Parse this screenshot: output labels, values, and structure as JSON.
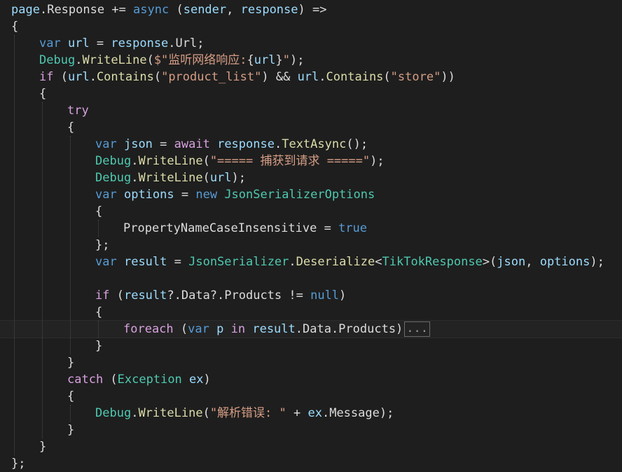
{
  "editor": {
    "lines": [
      {
        "indent": 0,
        "tokens": [
          {
            "t": "page",
            "c": "var"
          },
          {
            "t": ".",
            "c": "plain"
          },
          {
            "t": "Response",
            "c": "plain"
          },
          {
            "t": " += ",
            "c": "plain"
          },
          {
            "t": "async",
            "c": "kw"
          },
          {
            "t": " (",
            "c": "plain"
          },
          {
            "t": "sender",
            "c": "var"
          },
          {
            "t": ", ",
            "c": "plain"
          },
          {
            "t": "response",
            "c": "var"
          },
          {
            "t": ") =>",
            "c": "plain"
          }
        ]
      },
      {
        "indent": 0,
        "tokens": [
          {
            "t": "{",
            "c": "plain"
          }
        ]
      },
      {
        "indent": 1,
        "tokens": [
          {
            "t": "var",
            "c": "kw"
          },
          {
            "t": " ",
            "c": "plain"
          },
          {
            "t": "url",
            "c": "var"
          },
          {
            "t": " = ",
            "c": "plain"
          },
          {
            "t": "response",
            "c": "var"
          },
          {
            "t": ".",
            "c": "plain"
          },
          {
            "t": "Url",
            "c": "plain"
          },
          {
            "t": ";",
            "c": "plain"
          }
        ]
      },
      {
        "indent": 1,
        "tokens": [
          {
            "t": "Debug",
            "c": "type"
          },
          {
            "t": ".",
            "c": "plain"
          },
          {
            "t": "WriteLine",
            "c": "method"
          },
          {
            "t": "(",
            "c": "plain"
          },
          {
            "t": "$\"监听网络响应:",
            "c": "str"
          },
          {
            "t": "{",
            "c": "plain"
          },
          {
            "t": "url",
            "c": "var"
          },
          {
            "t": "}",
            "c": "plain"
          },
          {
            "t": "\"",
            "c": "str"
          },
          {
            "t": ");",
            "c": "plain"
          }
        ]
      },
      {
        "indent": 1,
        "tokens": [
          {
            "t": "if",
            "c": "ctl"
          },
          {
            "t": " (",
            "c": "plain"
          },
          {
            "t": "url",
            "c": "var"
          },
          {
            "t": ".",
            "c": "plain"
          },
          {
            "t": "Contains",
            "c": "method"
          },
          {
            "t": "(",
            "c": "plain"
          },
          {
            "t": "\"product_list\"",
            "c": "str"
          },
          {
            "t": ") && ",
            "c": "plain"
          },
          {
            "t": "url",
            "c": "var"
          },
          {
            "t": ".",
            "c": "plain"
          },
          {
            "t": "Contains",
            "c": "method"
          },
          {
            "t": "(",
            "c": "plain"
          },
          {
            "t": "\"store\"",
            "c": "str"
          },
          {
            "t": "))",
            "c": "plain"
          }
        ]
      },
      {
        "indent": 1,
        "tokens": [
          {
            "t": "{",
            "c": "plain"
          }
        ]
      },
      {
        "indent": 2,
        "tokens": [
          {
            "t": "try",
            "c": "ctl"
          }
        ]
      },
      {
        "indent": 2,
        "tokens": [
          {
            "t": "{",
            "c": "plain"
          }
        ]
      },
      {
        "indent": 3,
        "tokens": [
          {
            "t": "var",
            "c": "kw"
          },
          {
            "t": " ",
            "c": "plain"
          },
          {
            "t": "json",
            "c": "var"
          },
          {
            "t": " = ",
            "c": "plain"
          },
          {
            "t": "await",
            "c": "ctl"
          },
          {
            "t": " ",
            "c": "plain"
          },
          {
            "t": "response",
            "c": "var"
          },
          {
            "t": ".",
            "c": "plain"
          },
          {
            "t": "TextAsync",
            "c": "method"
          },
          {
            "t": "();",
            "c": "plain"
          }
        ]
      },
      {
        "indent": 3,
        "tokens": [
          {
            "t": "Debug",
            "c": "type"
          },
          {
            "t": ".",
            "c": "plain"
          },
          {
            "t": "WriteLine",
            "c": "method"
          },
          {
            "t": "(",
            "c": "plain"
          },
          {
            "t": "\"===== 捕获到请求 =====\"",
            "c": "str"
          },
          {
            "t": ");",
            "c": "plain"
          }
        ]
      },
      {
        "indent": 3,
        "tokens": [
          {
            "t": "Debug",
            "c": "type"
          },
          {
            "t": ".",
            "c": "plain"
          },
          {
            "t": "WriteLine",
            "c": "method"
          },
          {
            "t": "(",
            "c": "plain"
          },
          {
            "t": "url",
            "c": "var"
          },
          {
            "t": ");",
            "c": "plain"
          }
        ]
      },
      {
        "indent": 3,
        "tokens": [
          {
            "t": "var",
            "c": "kw"
          },
          {
            "t": " ",
            "c": "plain"
          },
          {
            "t": "options",
            "c": "var"
          },
          {
            "t": " = ",
            "c": "plain"
          },
          {
            "t": "new",
            "c": "kw"
          },
          {
            "t": " ",
            "c": "plain"
          },
          {
            "t": "JsonSerializerOptions",
            "c": "type"
          }
        ]
      },
      {
        "indent": 3,
        "tokens": [
          {
            "t": "{",
            "c": "plain"
          }
        ]
      },
      {
        "indent": 4,
        "tokens": [
          {
            "t": "PropertyNameCaseInsensitive",
            "c": "plain"
          },
          {
            "t": " = ",
            "c": "plain"
          },
          {
            "t": "true",
            "c": "kw"
          }
        ]
      },
      {
        "indent": 3,
        "tokens": [
          {
            "t": "};",
            "c": "plain"
          }
        ]
      },
      {
        "indent": 3,
        "tokens": [
          {
            "t": "var",
            "c": "kw"
          },
          {
            "t": " ",
            "c": "plain"
          },
          {
            "t": "result",
            "c": "var"
          },
          {
            "t": " = ",
            "c": "plain"
          },
          {
            "t": "JsonSerializer",
            "c": "type"
          },
          {
            "t": ".",
            "c": "plain"
          },
          {
            "t": "Deserialize",
            "c": "method"
          },
          {
            "t": "<",
            "c": "plain"
          },
          {
            "t": "TikTokResponse",
            "c": "type"
          },
          {
            "t": ">(",
            "c": "plain"
          },
          {
            "t": "json",
            "c": "var"
          },
          {
            "t": ", ",
            "c": "plain"
          },
          {
            "t": "options",
            "c": "var"
          },
          {
            "t": ");",
            "c": "plain"
          }
        ]
      },
      {
        "indent": 3,
        "tokens": []
      },
      {
        "indent": 3,
        "tokens": [
          {
            "t": "if",
            "c": "ctl"
          },
          {
            "t": " (",
            "c": "plain"
          },
          {
            "t": "result",
            "c": "var"
          },
          {
            "t": "?.Data?.Products != ",
            "c": "plain"
          },
          {
            "t": "null",
            "c": "kw"
          },
          {
            "t": ")",
            "c": "plain"
          }
        ]
      },
      {
        "indent": 3,
        "tokens": [
          {
            "t": "{",
            "c": "plain"
          }
        ]
      },
      {
        "indent": 4,
        "current": true,
        "collapsed": "...",
        "tokens": [
          {
            "t": "foreach",
            "c": "ctl"
          },
          {
            "t": " (",
            "c": "plain"
          },
          {
            "t": "var",
            "c": "kw"
          },
          {
            "t": " ",
            "c": "plain"
          },
          {
            "t": "p",
            "c": "var"
          },
          {
            "t": " ",
            "c": "plain"
          },
          {
            "t": "in",
            "c": "ctl"
          },
          {
            "t": " ",
            "c": "plain"
          },
          {
            "t": "result",
            "c": "var"
          },
          {
            "t": ".Data.Products)",
            "c": "plain"
          }
        ]
      },
      {
        "indent": 3,
        "tokens": [
          {
            "t": "}",
            "c": "plain"
          }
        ]
      },
      {
        "indent": 2,
        "tokens": [
          {
            "t": "}",
            "c": "plain"
          }
        ]
      },
      {
        "indent": 2,
        "tokens": [
          {
            "t": "catch",
            "c": "ctl"
          },
          {
            "t": " (",
            "c": "plain"
          },
          {
            "t": "Exception",
            "c": "type"
          },
          {
            "t": " ",
            "c": "plain"
          },
          {
            "t": "ex",
            "c": "var"
          },
          {
            "t": ")",
            "c": "plain"
          }
        ]
      },
      {
        "indent": 2,
        "tokens": [
          {
            "t": "{",
            "c": "plain"
          }
        ]
      },
      {
        "indent": 3,
        "tokens": [
          {
            "t": "Debug",
            "c": "type"
          },
          {
            "t": ".",
            "c": "plain"
          },
          {
            "t": "WriteLine",
            "c": "method"
          },
          {
            "t": "(",
            "c": "plain"
          },
          {
            "t": "\"解析错误: \"",
            "c": "str"
          },
          {
            "t": " + ",
            "c": "plain"
          },
          {
            "t": "ex",
            "c": "var"
          },
          {
            "t": ".Message);",
            "c": "plain"
          }
        ]
      },
      {
        "indent": 2,
        "tokens": [
          {
            "t": "}",
            "c": "plain"
          }
        ]
      },
      {
        "indent": 1,
        "tokens": [
          {
            "t": "}",
            "c": "plain"
          }
        ]
      },
      {
        "indent": 0,
        "tokens": [
          {
            "t": "};",
            "c": "plain"
          }
        ]
      }
    ]
  },
  "colors": {
    "background": "#1e1e1e",
    "keyword": "#569cd6",
    "control": "#d8a0df",
    "type": "#4ec9b0",
    "method": "#dcdcaa",
    "string": "#d69d85",
    "variable": "#9cdcfe",
    "plain": "#dcdcdc"
  }
}
